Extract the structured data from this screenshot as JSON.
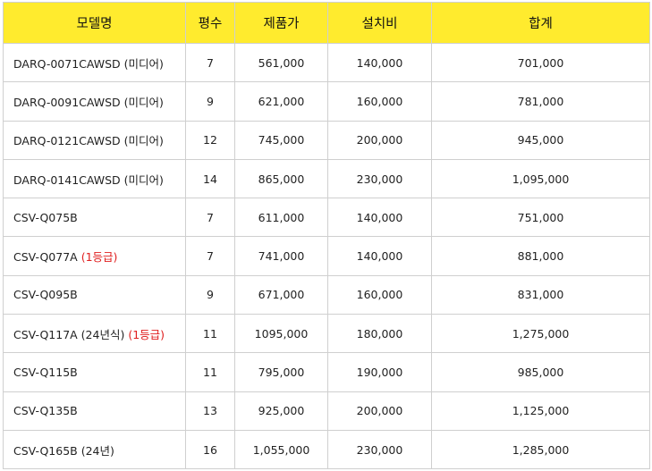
{
  "header": [
    "모델명",
    "평수",
    "제품가",
    "설치비",
    "합계"
  ],
  "rows": [
    {
      "model": "DARQ-0071CAWSD (미디어)",
      "badge": "",
      "size": "7",
      "price": "561,000",
      "install": "140,000",
      "total": "701,000"
    },
    {
      "model": "DARQ-0091CAWSD (미디어)",
      "badge": "",
      "size": "9",
      "price": "621,000",
      "install": "160,000",
      "total": "781,000"
    },
    {
      "model": "DARQ-0121CAWSD (미디어)",
      "badge": "",
      "size": "12",
      "price": "745,000",
      "install": "200,000",
      "total": "945,000"
    },
    {
      "model": "DARQ-0141CAWSD (미디어)",
      "badge": "",
      "size": "14",
      "price": "865,000",
      "install": "230,000",
      "total": "1,095,000"
    },
    {
      "model": "CSV-Q075B",
      "badge": "",
      "size": "7",
      "price": "611,000",
      "install": "140,000",
      "total": "751,000"
    },
    {
      "model": "CSV-Q077A",
      "badge": "(1등급)",
      "size": "7",
      "price": "741,000",
      "install": "140,000",
      "total": "881,000"
    },
    {
      "model": "CSV-Q095B",
      "badge": "",
      "size": "9",
      "price": "671,000",
      "install": "160,000",
      "total": "831,000"
    },
    {
      "model": "CSV-Q117A (24년식)",
      "badge": "(1등급)",
      "size": "11",
      "price": "1095,000",
      "install": "180,000",
      "total": "1,275,000"
    },
    {
      "model": "CSV-Q115B",
      "badge": "",
      "size": "11",
      "price": "795,000",
      "install": "190,000",
      "total": "985,000"
    },
    {
      "model": "CSV-Q135B",
      "badge": "",
      "size": "13",
      "price": "925,000",
      "install": "200,000",
      "total": "1,125,000"
    },
    {
      "model": "CSV-Q165B (24년)",
      "badge": "",
      "size": "16",
      "price": "1,055,000",
      "install": "230,000",
      "total": "1,285,000"
    }
  ],
  "colors": {
    "header_bg": "#ffeb2e",
    "badge": "#e02020",
    "border": "#cfcfcf"
  }
}
